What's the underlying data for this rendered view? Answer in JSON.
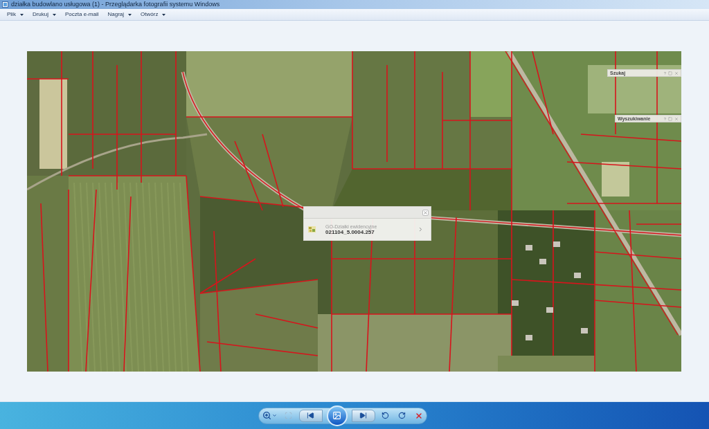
{
  "window": {
    "title": "działka budowlano usługowa (1) - Przeglądarka fotografii systemu Windows"
  },
  "menu": [
    {
      "label": "Plik",
      "dropdown": true
    },
    {
      "label": "Drukuj",
      "dropdown": true
    },
    {
      "label": "Poczta e-mail",
      "dropdown": false
    },
    {
      "label": "Nagraj",
      "dropdown": true
    },
    {
      "label": "Otwórz",
      "dropdown": true
    }
  ],
  "image": {
    "popup": {
      "layer": "GO-Działki ewidencyjne",
      "parcel_id": "021104_5.0004.257"
    },
    "panels": [
      {
        "title": "Szukaj",
        "help": "?"
      },
      {
        "title": "Wyszukiwanie",
        "help": "?"
      }
    ]
  },
  "toolbar": [
    {
      "kind": "zoom",
      "disabled": false
    },
    {
      "kind": "actual_size",
      "disabled": true
    },
    {
      "kind": "previous",
      "disabled": false
    },
    {
      "kind": "slideshow",
      "disabled": false
    },
    {
      "kind": "next",
      "disabled": false
    },
    {
      "kind": "rotate_left",
      "disabled": false
    },
    {
      "kind": "rotate_right",
      "disabled": false
    },
    {
      "kind": "delete",
      "disabled": false
    }
  ]
}
